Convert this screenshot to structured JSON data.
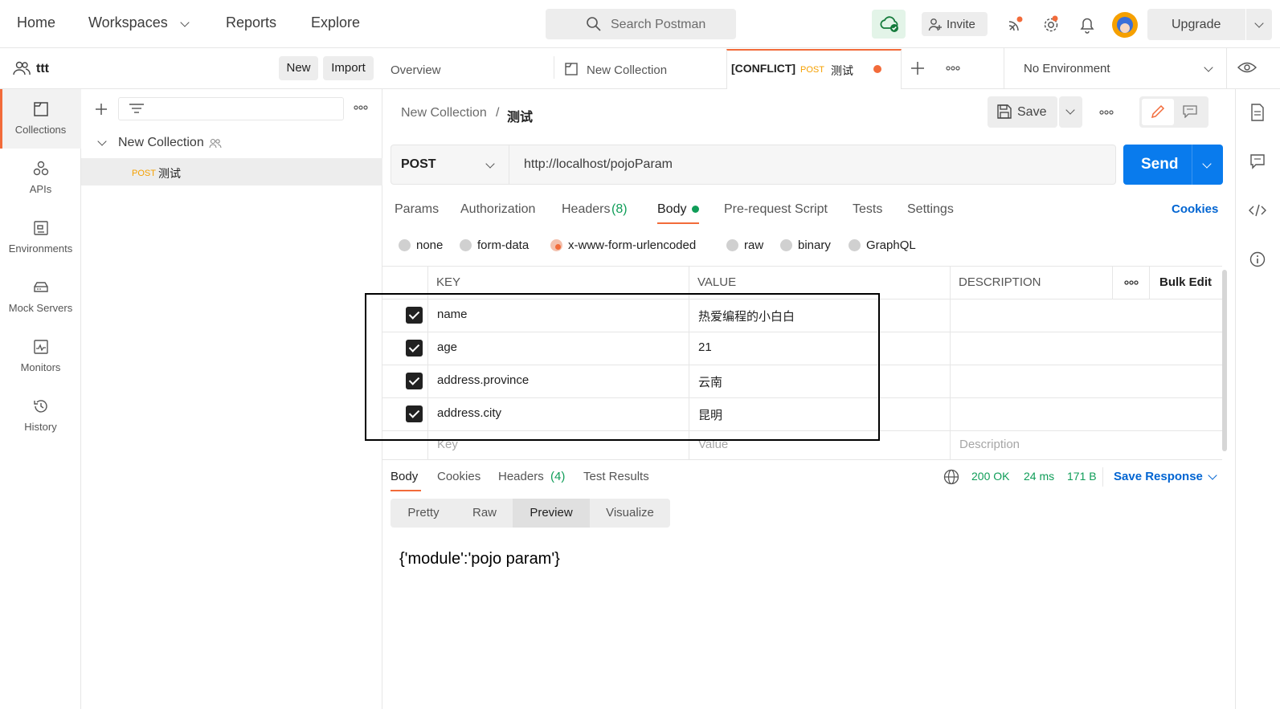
{
  "topnav": {
    "home": "Home",
    "workspaces": "Workspaces",
    "reports": "Reports",
    "explore": "Explore",
    "search_placeholder": "Search Postman",
    "invite": "Invite",
    "upgrade": "Upgrade"
  },
  "workspace": {
    "name": "ttt",
    "new_label": "New",
    "import_label": "Import"
  },
  "rail": [
    {
      "label": "Collections",
      "icon": "collections-icon"
    },
    {
      "label": "APIs",
      "icon": "apis-icon"
    },
    {
      "label": "Environments",
      "icon": "environments-icon"
    },
    {
      "label": "Mock Servers",
      "icon": "mock-servers-icon"
    },
    {
      "label": "Monitors",
      "icon": "monitors-icon"
    },
    {
      "label": "History",
      "icon": "history-icon"
    }
  ],
  "tree": {
    "collection_name": "New Collection",
    "request_method": "POST",
    "request_name": "测试"
  },
  "tabs": {
    "overview": "Overview",
    "new_collection": "New Collection",
    "conflict_label": "[CONFLICT]",
    "conflict_method": "POST",
    "conflict_name": "测试",
    "environment": "No Environment"
  },
  "request": {
    "breadcrumb_parent": "New Collection",
    "breadcrumb_sep": "/",
    "breadcrumb_current": "测试",
    "save_label": "Save",
    "method": "POST",
    "url": "http://localhost/pojoParam",
    "send_label": "Send",
    "tabs": {
      "params": "Params",
      "authorization": "Authorization",
      "headers": "Headers",
      "headers_count": "(8)",
      "body": "Body",
      "prerequest": "Pre-request Script",
      "tests": "Tests",
      "settings": "Settings",
      "cookies": "Cookies"
    },
    "body_types": {
      "none": "none",
      "form_data": "form-data",
      "urlencoded": "x-www-form-urlencoded",
      "raw": "raw",
      "binary": "binary",
      "graphql": "GraphQL"
    }
  },
  "table": {
    "headers": {
      "key": "KEY",
      "value": "VALUE",
      "description": "DESCRIPTION",
      "bulk_edit": "Bulk Edit"
    },
    "rows": [
      {
        "key": "name",
        "value": "热爱编程的小白白"
      },
      {
        "key": "age",
        "value": "21"
      },
      {
        "key": "address.province",
        "value": "云南"
      },
      {
        "key": "address.city",
        "value": "昆明"
      }
    ],
    "placeholders": {
      "key": "Key",
      "value": "Value",
      "description": "Description"
    }
  },
  "response": {
    "tabs": {
      "body": "Body",
      "cookies": "Cookies",
      "headers": "Headers",
      "headers_count": "(4)",
      "test_results": "Test Results"
    },
    "status": "200 OK",
    "time": "24 ms",
    "size": "171 B",
    "save_response": "Save Response",
    "views": {
      "pretty": "Pretty",
      "raw": "Raw",
      "preview": "Preview",
      "visualize": "Visualize"
    },
    "body_text": "{'module':'pojo param'}"
  },
  "colors": {
    "accent": "#f26b3a",
    "send_blue": "#097bed",
    "link_blue": "#0265d2",
    "success_green": "#0f9d58",
    "post_orange": "#f5a000"
  }
}
